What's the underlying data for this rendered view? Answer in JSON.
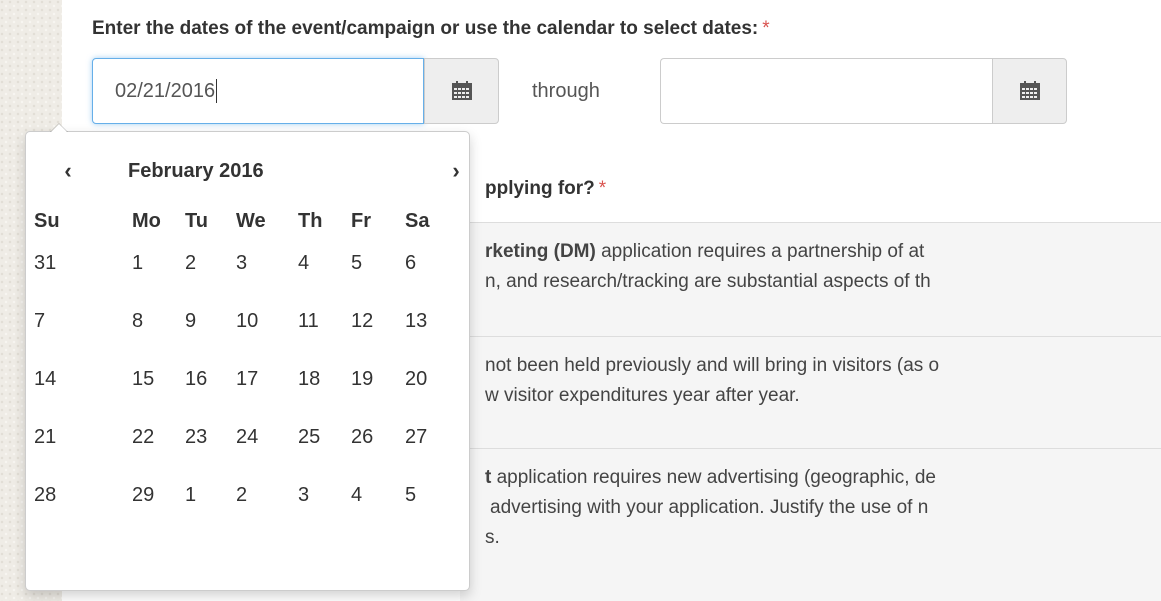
{
  "form": {
    "dates_label": "Enter the dates of the event/campaign or use the calendar to select dates:",
    "required_mark": "*",
    "start_date_value": "02/21/2016",
    "through_label": "through",
    "end_date_value": "",
    "apply_label_partial": "pplying for?",
    "options": [
      {
        "line1_bold": "rketing (DM)",
        "line1_rest": " application requires a partnership of at",
        "line2": "n, and research/tracking are substantial aspects of th"
      },
      {
        "line1": "not been held previously and will bring in visitors (as o",
        "line2": "w visitor expenditures year after year."
      },
      {
        "line1_bold": "t",
        "line1_rest": " application requires new advertising (geographic, de",
        "line2": "advertising with your application. Justify the use of n",
        "line3": "s."
      }
    ]
  },
  "icons": {
    "calendar": "calendar-icon",
    "prev": "chevron-left-icon",
    "next": "chevron-right-icon"
  },
  "datepicker": {
    "prev_symbol": "‹",
    "next_symbol": "›",
    "title": "February 2016",
    "days_of_week": [
      "Su",
      "Mo",
      "Tu",
      "We",
      "Th",
      "Fr",
      "Sa"
    ],
    "weeks": [
      [
        "31",
        "1",
        "2",
        "3",
        "4",
        "5",
        "6"
      ],
      [
        "7",
        "8",
        "9",
        "10",
        "11",
        "12",
        "13"
      ],
      [
        "14",
        "15",
        "16",
        "17",
        "18",
        "19",
        "20"
      ],
      [
        "21",
        "22",
        "23",
        "24",
        "25",
        "26",
        "27"
      ],
      [
        "28",
        "29",
        "1",
        "2",
        "3",
        "4",
        "5"
      ]
    ]
  },
  "colors": {
    "required": "#d9534f",
    "focus_border": "#66afe9",
    "addon_bg": "#eeeeee"
  }
}
